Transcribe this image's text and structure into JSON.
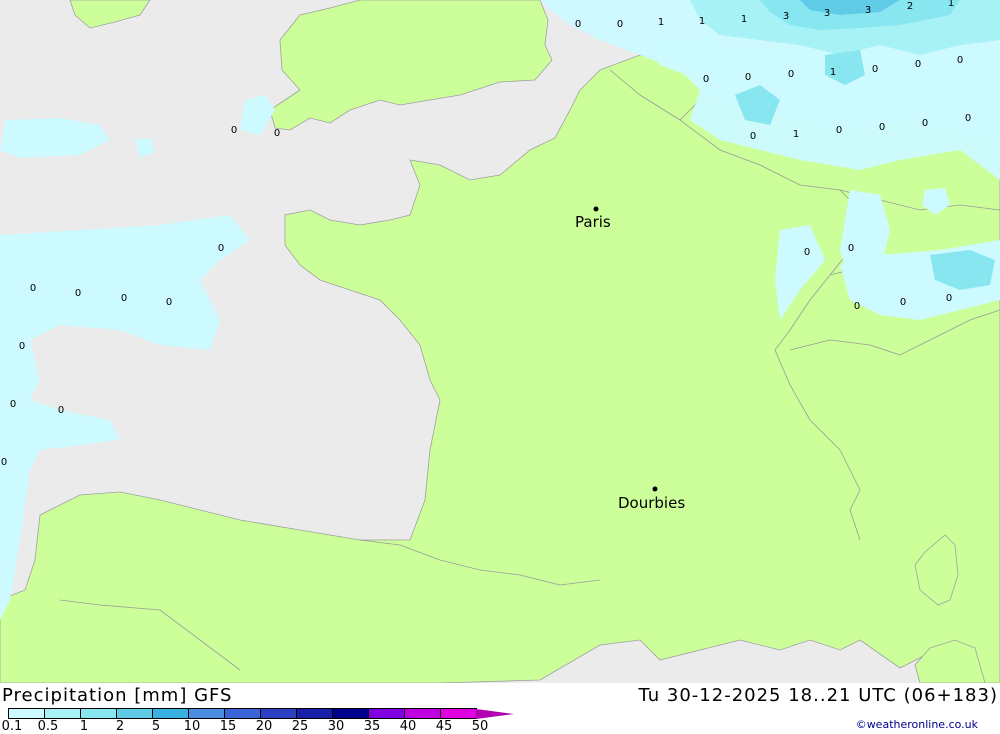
{
  "map": {
    "cities": [
      {
        "name": "Paris"
      },
      {
        "name": "Dourbies"
      }
    ],
    "contour_labels": [
      "0",
      "0",
      "1",
      "1",
      "1",
      "3",
      "3",
      "3",
      "2",
      "1",
      "0",
      "0",
      "0",
      "1",
      "0",
      "0",
      "0",
      "0",
      "1",
      "0",
      "0",
      "0",
      "0",
      "0",
      "0",
      "0",
      "0",
      "0",
      "0",
      "0",
      "0",
      "0",
      "0",
      "0",
      "0",
      "0",
      "0",
      "0",
      "0",
      "0"
    ],
    "colors": {
      "sea": "#ebebeb",
      "land": "#ccff99",
      "precip_0_1": "#ccfaff",
      "precip_0_5": "#a6f2f5",
      "precip_1": "#88e6f0",
      "precip_2": "#60cbe6"
    }
  },
  "footer": {
    "title": "Precipitation [mm] GFS",
    "datetime": "Tu 30-12-2025 18..21 UTC (06+183)",
    "copyright": "©weatheronline.co.uk"
  },
  "legend": {
    "ticks": [
      "0.1",
      "0.5",
      "1",
      "2",
      "5",
      "10",
      "15",
      "20",
      "25",
      "30",
      "35",
      "40",
      "45",
      "50"
    ],
    "colors": [
      "#ccfaff",
      "#a6f2f5",
      "#88e6f0",
      "#60cbe6",
      "#38b0e0",
      "#4a8ee0",
      "#3a64d8",
      "#2a40c0",
      "#1820a8",
      "#00008c",
      "#8000e0",
      "#c000e0",
      "#e000e0",
      "#b000b0"
    ]
  }
}
